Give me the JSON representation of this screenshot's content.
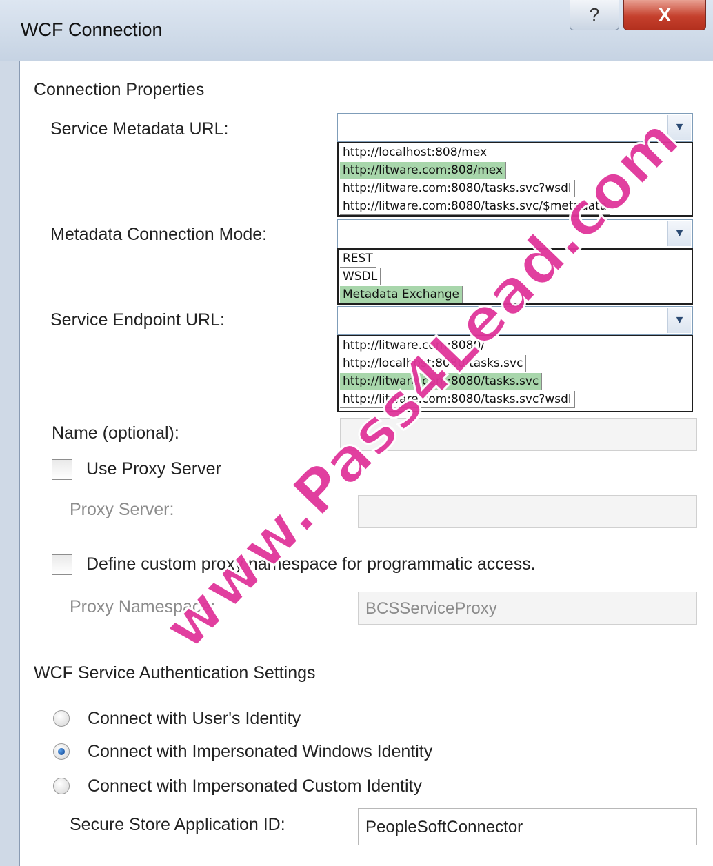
{
  "window": {
    "title": "WCF Connection",
    "help_glyph": "?",
    "close_glyph": "X"
  },
  "connection_properties": {
    "heading": "Connection Properties",
    "service_metadata_url": {
      "label": "Service Metadata URL:",
      "value": "",
      "options": [
        "http://localhost:808/mex",
        "http://litware.com:808/mex",
        "http://litware.com:8080/tasks.svc?wsdl",
        "http://litware.com:8080/tasks.svc/$metadata"
      ],
      "highlighted": "http://litware.com:808/mex"
    },
    "metadata_connection_mode": {
      "label": "Metadata Connection Mode:",
      "value": "",
      "options": [
        "REST",
        "WSDL",
        "Metadata Exchange"
      ],
      "highlighted": "Metadata Exchange"
    },
    "service_endpoint_url": {
      "label": "Service Endpoint URL:",
      "value": "",
      "options": [
        "http://litware.com:8080/",
        "http://localhost:8080/tasks.svc",
        "http://litware.com:8080/tasks.svc",
        "http://litware.com:8080/tasks.svc?wsdl"
      ],
      "highlighted": "http://litware.com:8080/tasks.svc"
    },
    "name_optional": {
      "label": "Name (optional):",
      "value": ""
    },
    "use_proxy_server": {
      "label": "Use Proxy Server",
      "checked": false
    },
    "proxy_server": {
      "label": "Proxy Server:",
      "value": ""
    },
    "custom_namespace": {
      "label": "Define custom proxy namespace for programmatic access.",
      "checked": false
    },
    "proxy_namespace": {
      "label": "Proxy Namespace:",
      "value": "BCSServiceProxy"
    }
  },
  "authentication": {
    "heading": "WCF Service Authentication Settings",
    "options": [
      {
        "label": "Connect with User's Identity",
        "selected": false
      },
      {
        "label": "Connect with Impersonated Windows Identity",
        "selected": true
      },
      {
        "label": "Connect with Impersonated Custom Identity",
        "selected": false
      }
    ],
    "secure_store_app_id": {
      "label": "Secure Store Application ID:",
      "value": "PeopleSoftConnector"
    }
  },
  "watermark": "www.Pass4Lead.com",
  "colors": {
    "highlight": "#a8d6ab",
    "close_button": "#c5402d",
    "watermark": "#e0359a"
  }
}
